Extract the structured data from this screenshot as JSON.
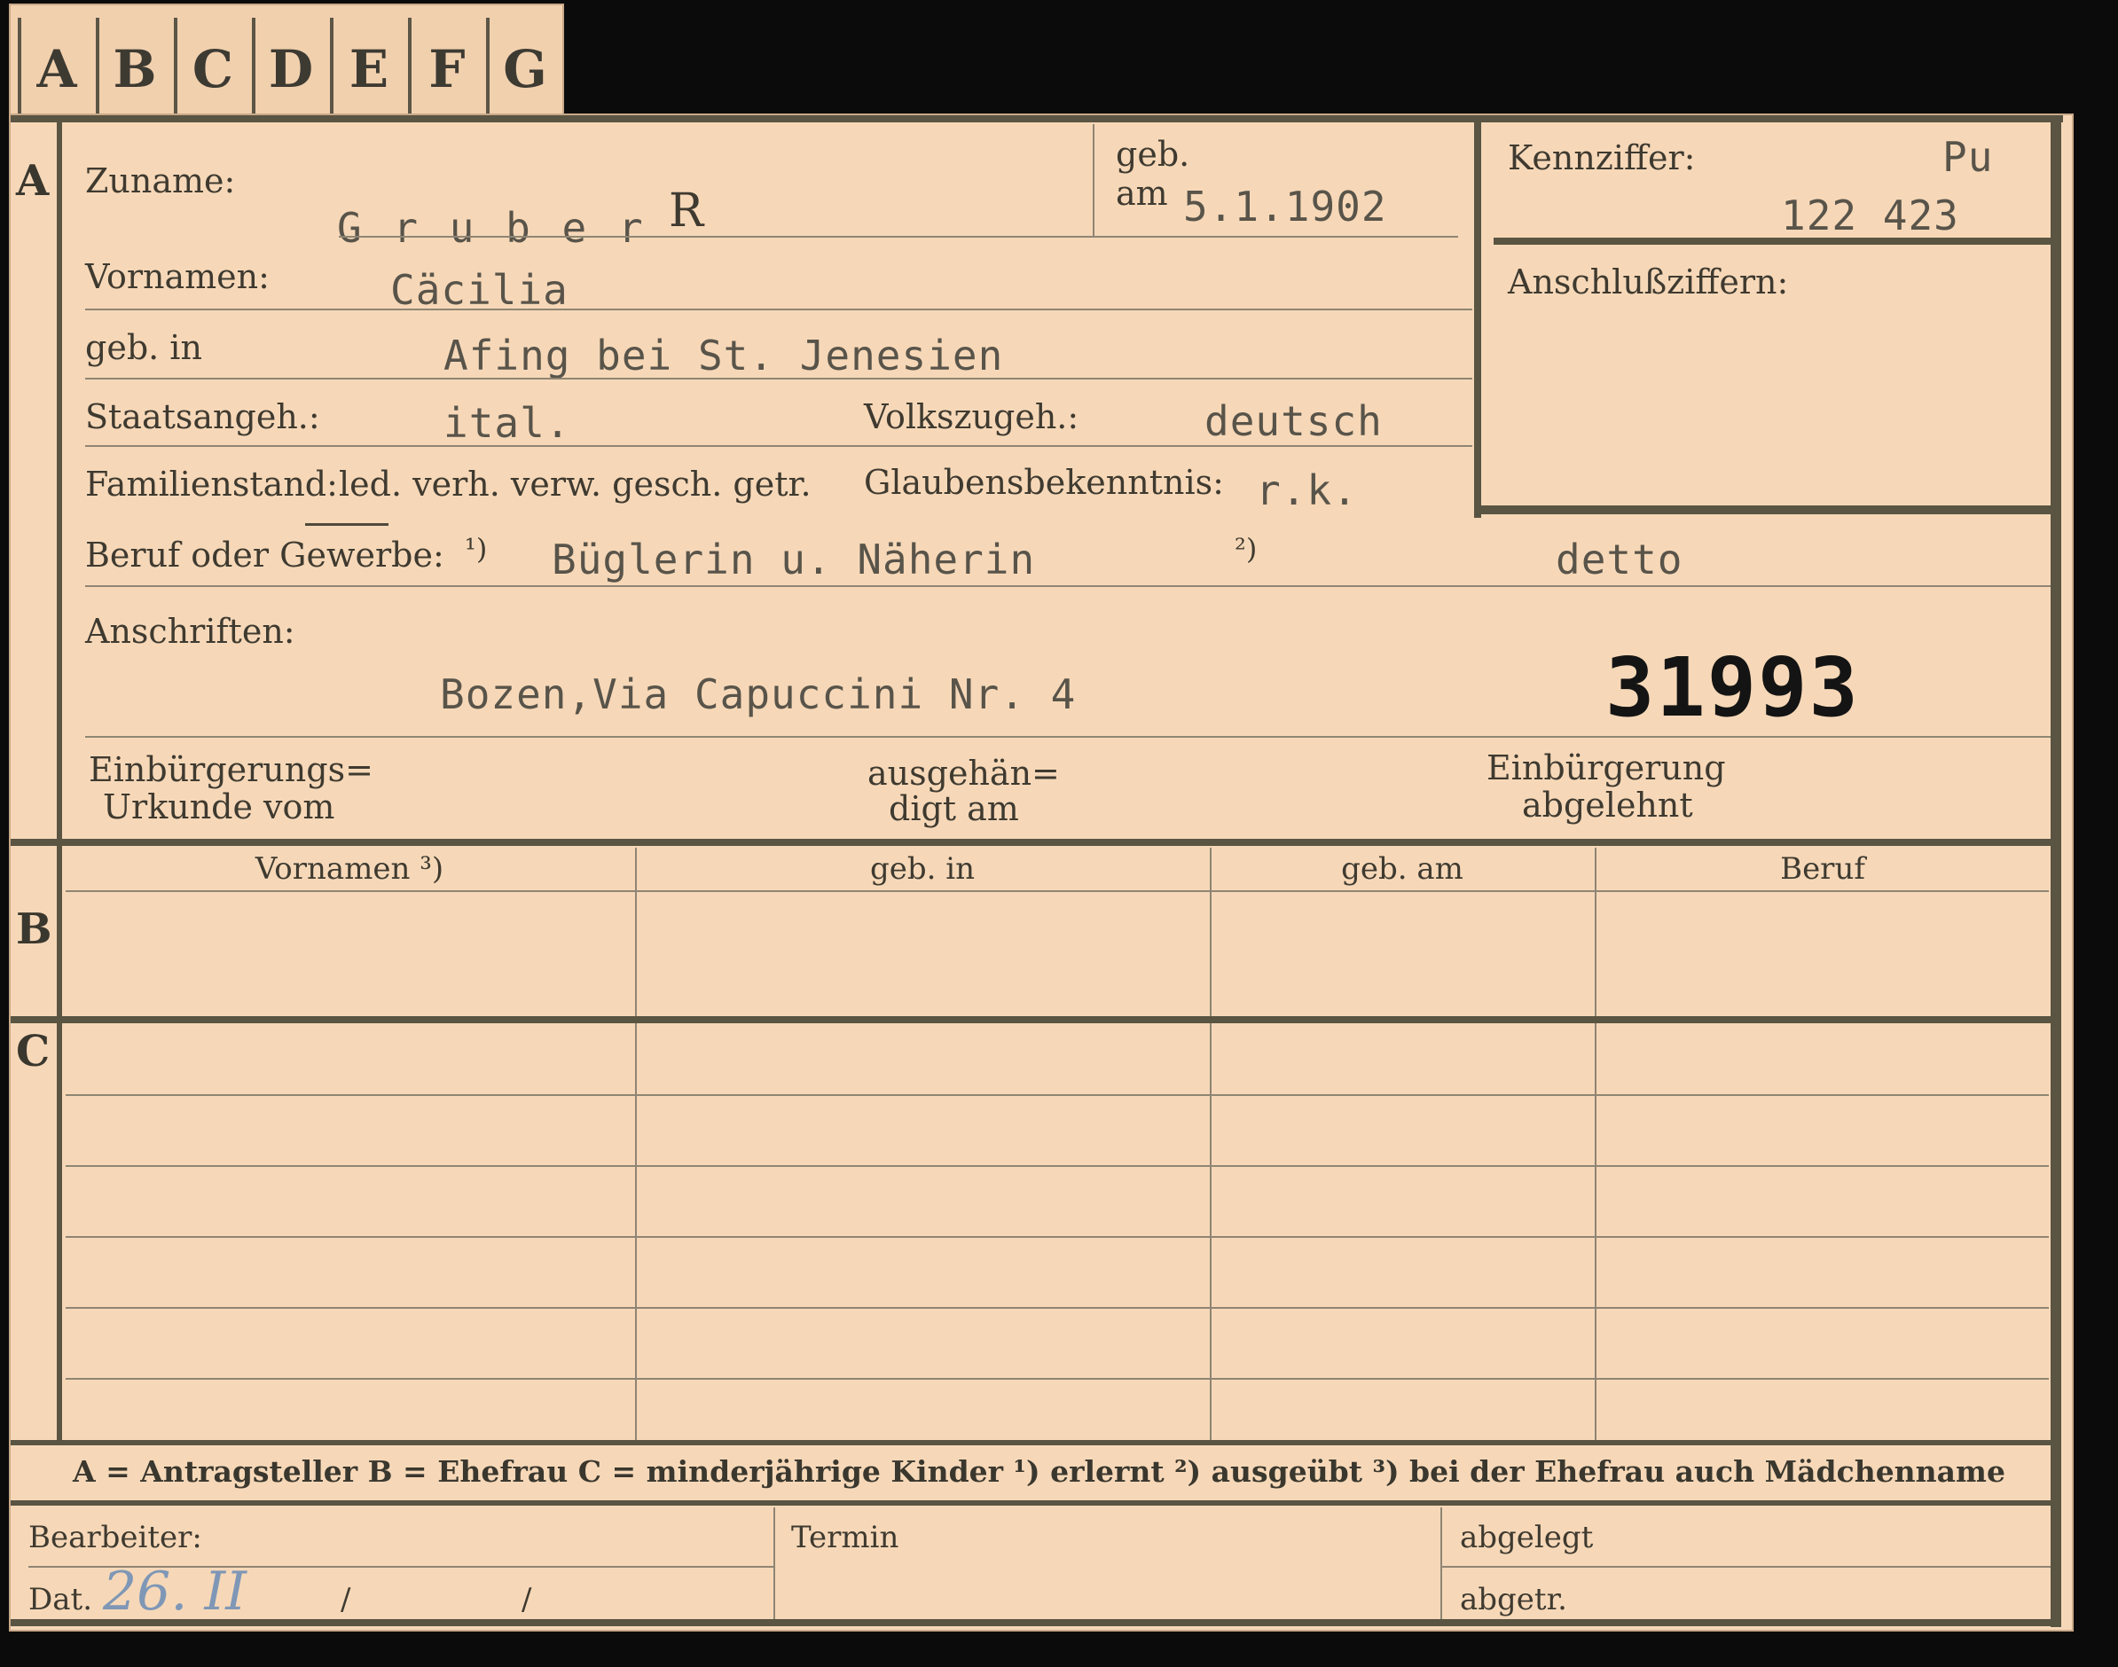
{
  "tabs": [
    "A",
    "B",
    "C",
    "D",
    "E",
    "F",
    "G"
  ],
  "sections": {
    "a": "A",
    "b": "B",
    "c": "C"
  },
  "labels": {
    "zuname": "Zuname:",
    "geb": "geb.",
    "am": "am",
    "kennziffer": "Kennziffer:",
    "anschlussziffern": "Anschlußziffern:",
    "vornamen": "Vornamen:",
    "geb_in": "geb. in",
    "staatsangeh": "Staatsangeh.:",
    "volkszugeh": "Volkszugeh.:",
    "familienstand": "Familienstand:",
    "familienstand_options": "led. verh. verw. gesch. getr.",
    "glaubensbekenntnis": "Glaubensbekenntnis:",
    "beruf": "Beruf oder Gewerbe:",
    "beruf_note1": "¹)",
    "beruf_note2": "²)",
    "anschriften": "Anschriften:",
    "einbuergerungs_1": "Einbürgerungs=",
    "einbuergerungs_2": "Urkunde vom",
    "ausgehaen_1": "ausgehän=",
    "ausgehaen_2": "digt am",
    "einbuergerung_1": "Einbürgerung",
    "einbuergerung_2": "abgelehnt"
  },
  "values": {
    "zuname": "G r u b e r",
    "zuname_mark": "R",
    "geb_am": "5.1.1902",
    "kennziffer_prefix": "Pu",
    "kennziffer": "122 423",
    "vornamen": "Cäcilia",
    "geb_in": "Afing bei St. Jenesien",
    "staatsangeh": "ital.",
    "volkszugeh": "deutsch",
    "glaubensbekenntnis": "r.k.",
    "beruf_1": "Büglerin u. Näherin",
    "beruf_2": "detto",
    "anschrift": "Bozen,Via Capuccini Nr. 4",
    "stamp_number": "31993"
  },
  "table": {
    "columns": [
      "Vornamen ³)",
      "geb. in",
      "geb. am",
      "Beruf"
    ]
  },
  "legend": "A = Antragsteller   B = Ehefrau   C = minderjährige Kinder   ¹) erlernt   ²) ausgeübt   ³) bei der Ehefrau auch Mädchenname",
  "footer": {
    "bearbeiter": "Bearbeiter:",
    "dat": "Dat.",
    "dat_handwritten": "26. II",
    "slash1": "/",
    "slash2": "/",
    "termin": "Termin",
    "abgelegt": "abgelegt",
    "abgetr": "abgetr."
  }
}
